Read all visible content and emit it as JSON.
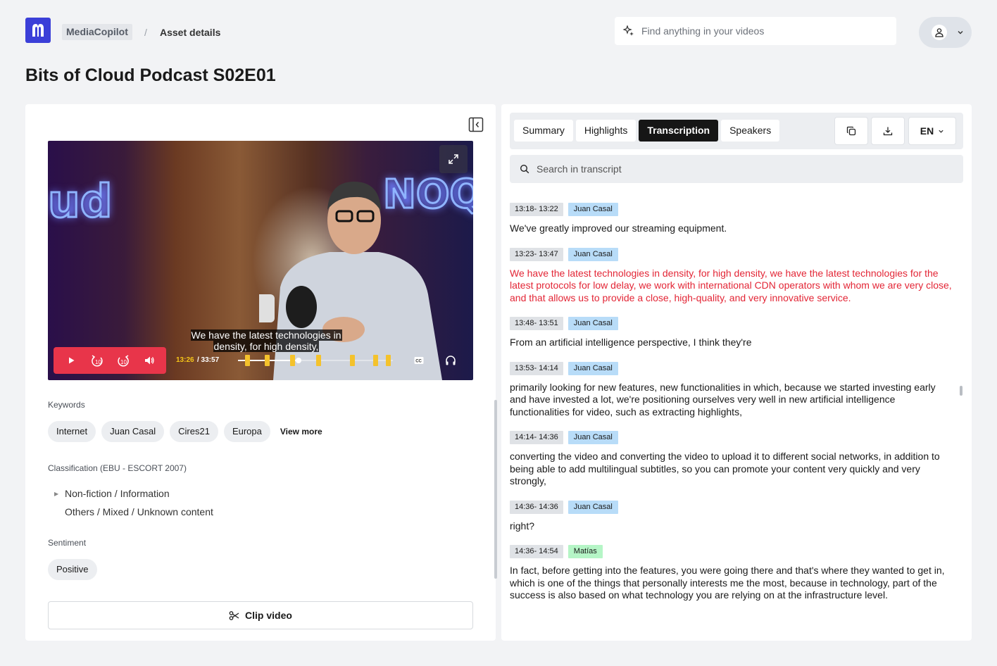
{
  "header": {
    "app_name": "MediaCopilot",
    "breadcrumb_sep": "/",
    "breadcrumb_current": "Asset details",
    "search_placeholder": "Find anything in your videos"
  },
  "page": {
    "title": "Bits of Cloud Podcast S02E01"
  },
  "player": {
    "caption_line1": "We have the latest technologies in",
    "caption_line2": "density, for high density,",
    "current_time": "13:26",
    "total_time": "/ 33:57",
    "progress": 0.39,
    "highlight_positions": [
      0.06,
      0.19,
      0.35,
      0.52,
      0.74,
      0.89,
      0.97
    ],
    "skip_back_label": "10",
    "skip_fwd_label": "10",
    "accent_color": "#e8354a",
    "marker_color": "#f4c22c"
  },
  "keywords": {
    "label": "Keywords",
    "items": [
      "Internet",
      "Juan Casal",
      "Cires21",
      "Europa"
    ],
    "view_more": "View more"
  },
  "classification": {
    "label": "Classification (EBU - ESCORT 2007)",
    "items": [
      "Non-fiction / Information",
      "Others / Mixed / Unknown content"
    ]
  },
  "sentiment": {
    "label": "Sentiment",
    "value": "Positive"
  },
  "clip_button": "Clip video",
  "tabs": [
    "Summary",
    "Highlights",
    "Transcription",
    "Speakers"
  ],
  "active_tab": "Transcription",
  "language": "EN",
  "transcript_search_placeholder": "Search in transcript",
  "transcript": [
    {
      "time": "13:18- 13:22",
      "speaker": "Juan Casal",
      "speaker_color": "#b8dcf8",
      "text": "We've greatly improved our streaming equipment.",
      "active": false
    },
    {
      "time": "13:23- 13:47",
      "speaker": "Juan Casal",
      "speaker_color": "#b8dcf8",
      "text": "We have the latest technologies in density, for high density, we have the latest technologies for the latest protocols for low delay, we work with international CDN operators with whom we are very close, and that allows us to provide a close, high-quality, and very innovative service.",
      "active": true
    },
    {
      "time": "13:48- 13:51",
      "speaker": "Juan Casal",
      "speaker_color": "#b8dcf8",
      "text": "From an artificial intelligence perspective, I think they're",
      "active": false
    },
    {
      "time": "13:53- 14:14",
      "speaker": "Juan Casal",
      "speaker_color": "#b8dcf8",
      "text": "primarily looking for new features, new functionalities in which, because we started investing early and have invested a lot, we're positioning ourselves very well in new artificial intelligence functionalities for video, such as extracting highlights,",
      "active": false
    },
    {
      "time": "14:14- 14:36",
      "speaker": "Juan Casal",
      "speaker_color": "#b8dcf8",
      "text": "converting the video and converting the video to upload it to different social networks, in addition to being able to add multilingual subtitles, so you can promote your content very quickly and very strongly,",
      "active": false
    },
    {
      "time": "14:36- 14:36",
      "speaker": "Juan Casal",
      "speaker_color": "#b8dcf8",
      "text": "right?",
      "active": false
    },
    {
      "time": "14:36- 14:54",
      "speaker": "Matías",
      "speaker_color": "#b5f5c6",
      "text": "In fact, before getting into the features, you were going there and that's where they wanted to get in, which is one of the things that personally interests me the most, because in technology, part of the success is also based on what technology you are relying on at the infrastructure level.",
      "active": false
    }
  ]
}
